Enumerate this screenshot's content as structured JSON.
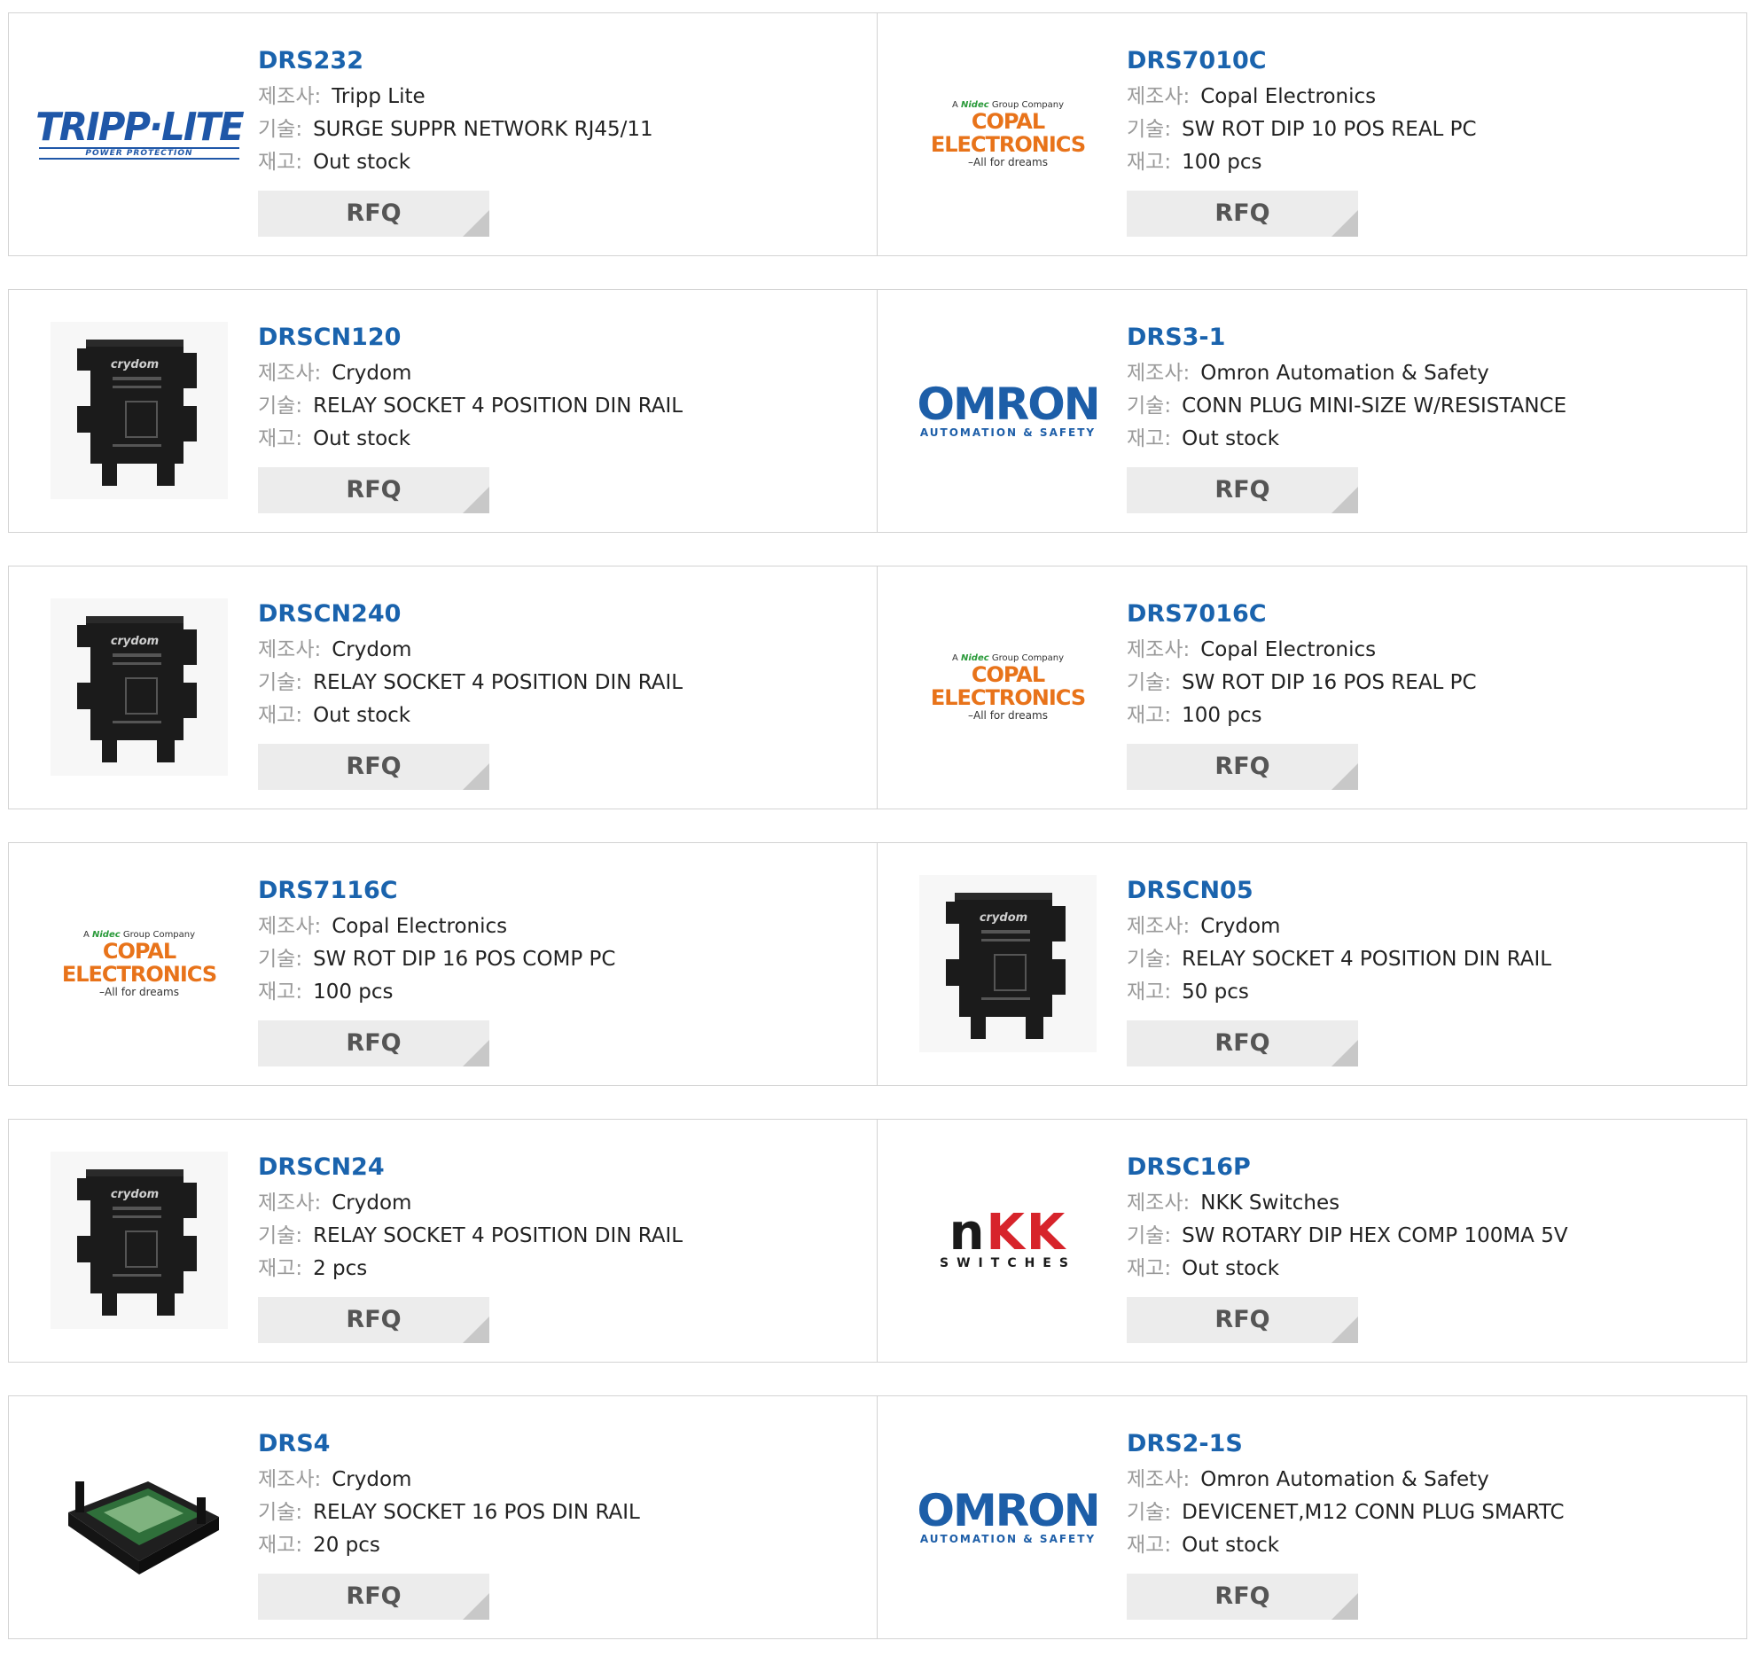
{
  "labels": {
    "mfr": "제조사:",
    "desc": "기술:",
    "stock": "재고:",
    "rfq": "RFQ"
  },
  "products": [
    {
      "pn": "DRS232",
      "mfr": "Tripp Lite",
      "desc": "SURGE SUPPR NETWORK RJ45/11",
      "stock": "Out stock",
      "logo": "tripp-lite-logo"
    },
    {
      "pn": "DRS7010C",
      "mfr": "Copal Electronics",
      "desc": "SW ROT DIP 10 POS REAL PC",
      "stock": "100 pcs",
      "logo": "copal-electronics-logo"
    },
    {
      "pn": "DRSCN120",
      "mfr": "Crydom",
      "desc": "RELAY SOCKET 4 POSITION DIN RAIL",
      "stock": "Out stock",
      "logo": "relay-socket-image"
    },
    {
      "pn": "DRS3-1",
      "mfr": "Omron Automation & Safety",
      "desc": "CONN PLUG MINI-SIZE W/RESISTANCE",
      "stock": "Out stock",
      "logo": "omron-logo"
    },
    {
      "pn": "DRSCN240",
      "mfr": "Crydom",
      "desc": "RELAY SOCKET 4 POSITION DIN RAIL",
      "stock": "Out stock",
      "logo": "relay-socket-image"
    },
    {
      "pn": "DRS7016C",
      "mfr": "Copal Electronics",
      "desc": "SW ROT DIP 16 POS REAL PC",
      "stock": "100 pcs",
      "logo": "copal-electronics-logo"
    },
    {
      "pn": "DRS7116C",
      "mfr": "Copal Electronics",
      "desc": "SW ROT DIP 16 POS COMP PC",
      "stock": "100 pcs",
      "logo": "copal-electronics-logo"
    },
    {
      "pn": "DRSCN05",
      "mfr": "Crydom",
      "desc": "RELAY SOCKET 4 POSITION DIN RAIL",
      "stock": "50 pcs",
      "logo": "relay-socket-image"
    },
    {
      "pn": "DRSCN24",
      "mfr": "Crydom",
      "desc": "RELAY SOCKET 4 POSITION DIN RAIL",
      "stock": "2 pcs",
      "logo": "relay-socket-image"
    },
    {
      "pn": "DRSC16P",
      "mfr": "NKK Switches",
      "desc": "SW ROTARY DIP HEX COMP 100MA 5V",
      "stock": "Out stock",
      "logo": "nkk-switches-logo"
    },
    {
      "pn": "DRS4",
      "mfr": "Crydom",
      "desc": "RELAY SOCKET 16 POS DIN RAIL",
      "stock": "20 pcs",
      "logo": "relay-board-image"
    },
    {
      "pn": "DRS2-1S",
      "mfr": "Omron Automation & Safety",
      "desc": "DEVICENET,M12 CONN PLUG SMARTC",
      "stock": "Out stock",
      "logo": "omron-logo"
    }
  ],
  "logo_text": {
    "tripp": {
      "main": "TRIPP·LITE",
      "sub": "POWER PROTECTION"
    },
    "copal": {
      "top_a": "A",
      "top_brand": "Nidec",
      "top_rest": "Group Company",
      "main": "COPAL ELECTRONICS",
      "tag": "–All for dreams"
    },
    "omron": {
      "main": "OMRON",
      "sub": "AUTOMATION & SAFETY"
    },
    "nkk": {
      "n": "n",
      "kk": "KK",
      "sub": "SWITCHES"
    },
    "crydom": {
      "brand": "crydom"
    }
  },
  "colors": {
    "part_number": "#1a63ad",
    "label": "#9a9a9a",
    "rfq_bg": "#ececec",
    "border": "#d3d3d3"
  }
}
